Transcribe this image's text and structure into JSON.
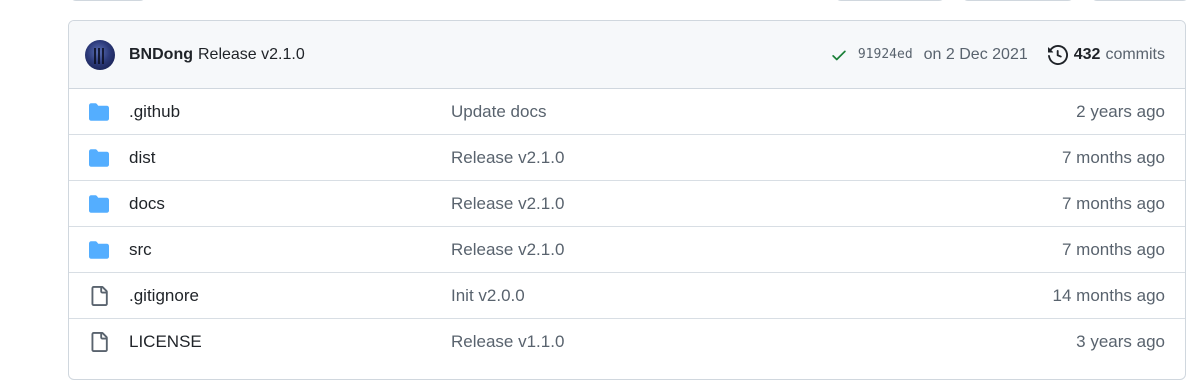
{
  "commit": {
    "author": "BNDong",
    "message": "Release v2.1.0",
    "sha": "91924ed",
    "date": "on 2 Dec 2021",
    "commit_count": "432",
    "commits_label": "commits"
  },
  "colors": {
    "folder": "#54aeff",
    "check": "#1a7f37",
    "file": "#59636e"
  },
  "files": [
    {
      "type": "folder",
      "icon": "folder-icon",
      "name": ".github",
      "message": "Update docs",
      "age": "2 years ago"
    },
    {
      "type": "folder",
      "icon": "folder-icon",
      "name": "dist",
      "message": "Release v2.1.0",
      "age": "7 months ago"
    },
    {
      "type": "folder",
      "icon": "folder-icon",
      "name": "docs",
      "message": "Release v2.1.0",
      "age": "7 months ago"
    },
    {
      "type": "folder",
      "icon": "folder-icon",
      "name": "src",
      "message": "Release v2.1.0",
      "age": "7 months ago"
    },
    {
      "type": "file",
      "icon": "file-icon",
      "name": ".gitignore",
      "message": "Init v2.0.0",
      "age": "14 months ago"
    },
    {
      "type": "file",
      "icon": "file-icon",
      "name": "LICENSE",
      "message": "Release v1.1.0",
      "age": "3 years ago"
    }
  ]
}
